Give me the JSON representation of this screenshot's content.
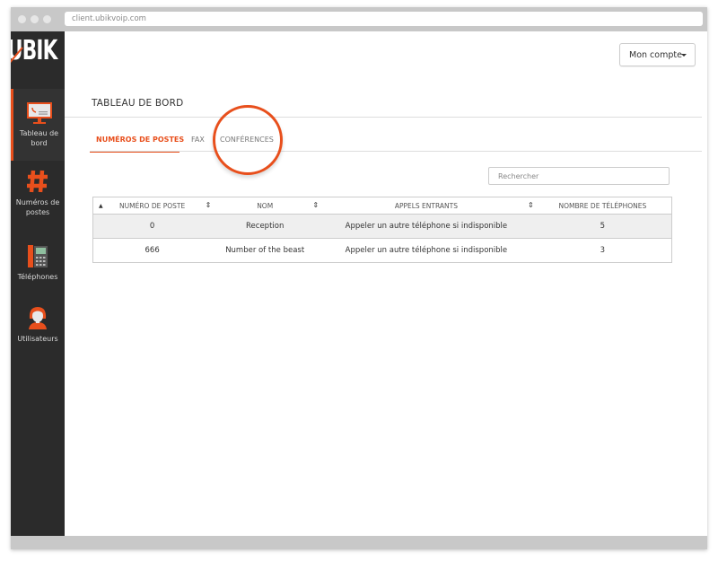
{
  "browser": {
    "url": "client.ubikvoip.com"
  },
  "brand": {
    "logo": "UBIK",
    "accent": "#e84f1c"
  },
  "sidebar": {
    "items": [
      {
        "label": "Tableau de bord",
        "icon": "monitor-phone-icon",
        "active": true
      },
      {
        "label": "Numéros de postes",
        "icon": "hash-icon",
        "active": false
      },
      {
        "label": "Téléphones",
        "icon": "desk-phone-icon",
        "active": false
      },
      {
        "label": "Utilisateurs",
        "icon": "user-icon",
        "active": false
      }
    ]
  },
  "header": {
    "account_label": "Mon compte"
  },
  "page": {
    "title": "TABLEAU DE BORD"
  },
  "tabs": [
    {
      "label": "NUMÉROS DE POSTES",
      "active": true
    },
    {
      "label": "FAX",
      "active": false
    },
    {
      "label": "CONFÉRENCES",
      "active": false
    }
  ],
  "search": {
    "placeholder": "Rechercher"
  },
  "table": {
    "columns": [
      "NUMÉRO DE POSTE",
      "NOM",
      "APPELS ENTRANTS",
      "NOMBRE DE TÉLÉPHONES"
    ],
    "rows": [
      {
        "poste": "0",
        "nom": "Reception",
        "appels": "Appeler un autre téléphone si indisponible",
        "telephones": "5"
      },
      {
        "poste": "666",
        "nom": "Number of the beast",
        "appels": "Appeler un autre téléphone si indisponible",
        "telephones": "3"
      }
    ]
  }
}
